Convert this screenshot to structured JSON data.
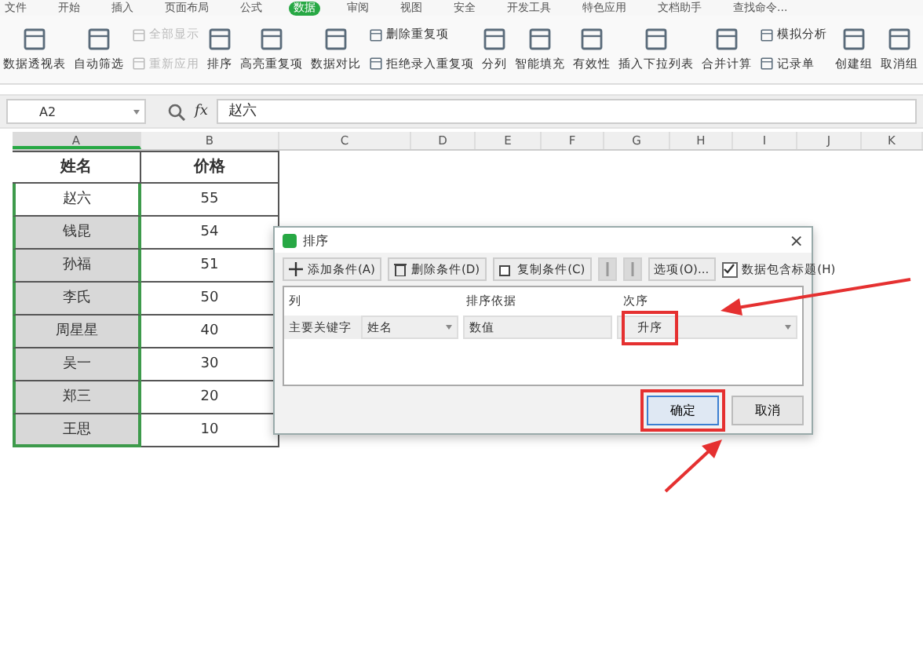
{
  "menu_tabs": [
    {
      "label": "文件",
      "selected": false
    },
    {
      "label": "开始",
      "selected": false
    },
    {
      "label": "插入",
      "selected": false
    },
    {
      "label": "页面布局",
      "selected": false
    },
    {
      "label": "公式",
      "selected": false
    },
    {
      "label": "数据",
      "selected": true
    },
    {
      "label": "审阅",
      "selected": false
    },
    {
      "label": "视图",
      "selected": false
    },
    {
      "label": "安全",
      "selected": false
    },
    {
      "label": "开发工具",
      "selected": false
    },
    {
      "label": "特色应用",
      "selected": false
    },
    {
      "label": "文档助手",
      "selected": false
    },
    {
      "label": "查找命令...",
      "selected": false
    }
  ],
  "ribbon": [
    [
      {
        "label": "数据透视表",
        "kind": "big",
        "disabled": false
      }
    ],
    [
      {
        "label": "自动筛选",
        "kind": "big",
        "disabled": false
      }
    ],
    [
      {
        "label": "全部显示",
        "kind": "small",
        "disabled": true
      },
      {
        "label": "重新应用",
        "kind": "small",
        "disabled": true
      }
    ],
    [
      {
        "label": "排序",
        "kind": "big",
        "disabled": false
      }
    ],
    [
      {
        "label": "高亮重复项",
        "kind": "big",
        "disabled": false
      }
    ],
    [
      {
        "label": "数据对比",
        "kind": "big",
        "disabled": false
      }
    ],
    [
      {
        "label": "删除重复项",
        "kind": "small",
        "disabled": false
      },
      {
        "label": "拒绝录入重复项",
        "kind": "small",
        "disabled": false
      }
    ],
    [
      {
        "label": "分列",
        "kind": "big",
        "disabled": false
      }
    ],
    [
      {
        "label": "智能填充",
        "kind": "big",
        "disabled": false
      }
    ],
    [
      {
        "label": "有效性",
        "kind": "big",
        "disabled": false
      }
    ],
    [
      {
        "label": "插入下拉列表",
        "kind": "big",
        "disabled": false
      }
    ],
    [
      {
        "label": "合并计算",
        "kind": "big",
        "disabled": false
      }
    ],
    [
      {
        "label": "模拟分析",
        "kind": "small",
        "disabled": false
      },
      {
        "label": "记录单",
        "kind": "small",
        "disabled": false
      }
    ],
    [
      {
        "label": "创建组",
        "kind": "big",
        "disabled": false
      }
    ],
    [
      {
        "label": "取消组",
        "kind": "big",
        "disabled": false
      }
    ]
  ],
  "formula_bar": {
    "cell_ref": "A2",
    "fx": "fx",
    "value": "赵六"
  },
  "sheet": {
    "columns": [
      {
        "label": "A",
        "selected": true
      },
      {
        "label": "B",
        "selected": false
      },
      {
        "label": "C",
        "selected": false
      },
      {
        "label": "D",
        "selected": false
      },
      {
        "label": "E",
        "selected": false
      },
      {
        "label": "F",
        "selected": false
      },
      {
        "label": "G",
        "selected": false
      },
      {
        "label": "H",
        "selected": false
      },
      {
        "label": "I",
        "selected": false
      },
      {
        "label": "J",
        "selected": false
      },
      {
        "label": "K",
        "selected": false
      }
    ],
    "rows": [
      {
        "kind": "header",
        "cells": [
          "姓名",
          "价格"
        ]
      },
      {
        "kind": "data",
        "cells": [
          "赵六",
          "55"
        ],
        "selected": true,
        "active": true
      },
      {
        "kind": "data",
        "cells": [
          "钱昆",
          "54"
        ],
        "selected": true,
        "active": false
      },
      {
        "kind": "data",
        "cells": [
          "孙福",
          "51"
        ],
        "selected": true,
        "active": false
      },
      {
        "kind": "data",
        "cells": [
          "李氏",
          "50"
        ],
        "selected": true,
        "active": false
      },
      {
        "kind": "data",
        "cells": [
          "周星星",
          "40"
        ],
        "selected": true,
        "active": false
      },
      {
        "kind": "data",
        "cells": [
          "吴一",
          "30"
        ],
        "selected": true,
        "active": false
      },
      {
        "kind": "data",
        "cells": [
          "郑三",
          "20"
        ],
        "selected": true,
        "active": false
      },
      {
        "kind": "data",
        "cells": [
          "王思",
          "10"
        ],
        "selected": true,
        "active": false
      }
    ]
  },
  "dialog": {
    "title": "排序",
    "close": "×",
    "toolbar": [
      {
        "label": "添加条件(A)",
        "kind": "add",
        "disabled": false
      },
      {
        "label": "删除条件(D)",
        "kind": "delete",
        "disabled": false
      },
      {
        "label": "复制条件(C)",
        "kind": "copy",
        "disabled": false
      },
      {
        "kind": "up",
        "disabled": true
      },
      {
        "kind": "down",
        "disabled": true
      },
      {
        "label": "选项(O)...",
        "kind": "text",
        "disabled": false
      }
    ],
    "header_checkbox": {
      "label": "数据包含标题(H)",
      "checked": true
    },
    "headers": [
      "列",
      "排序依据",
      "次序"
    ],
    "conditions": [
      {
        "label": "主要关键字",
        "column": "姓名",
        "basis": "数值",
        "order": "升序"
      }
    ],
    "buttons": [
      {
        "label": "确定",
        "selected": true
      },
      {
        "label": "取消",
        "selected": false
      }
    ]
  }
}
